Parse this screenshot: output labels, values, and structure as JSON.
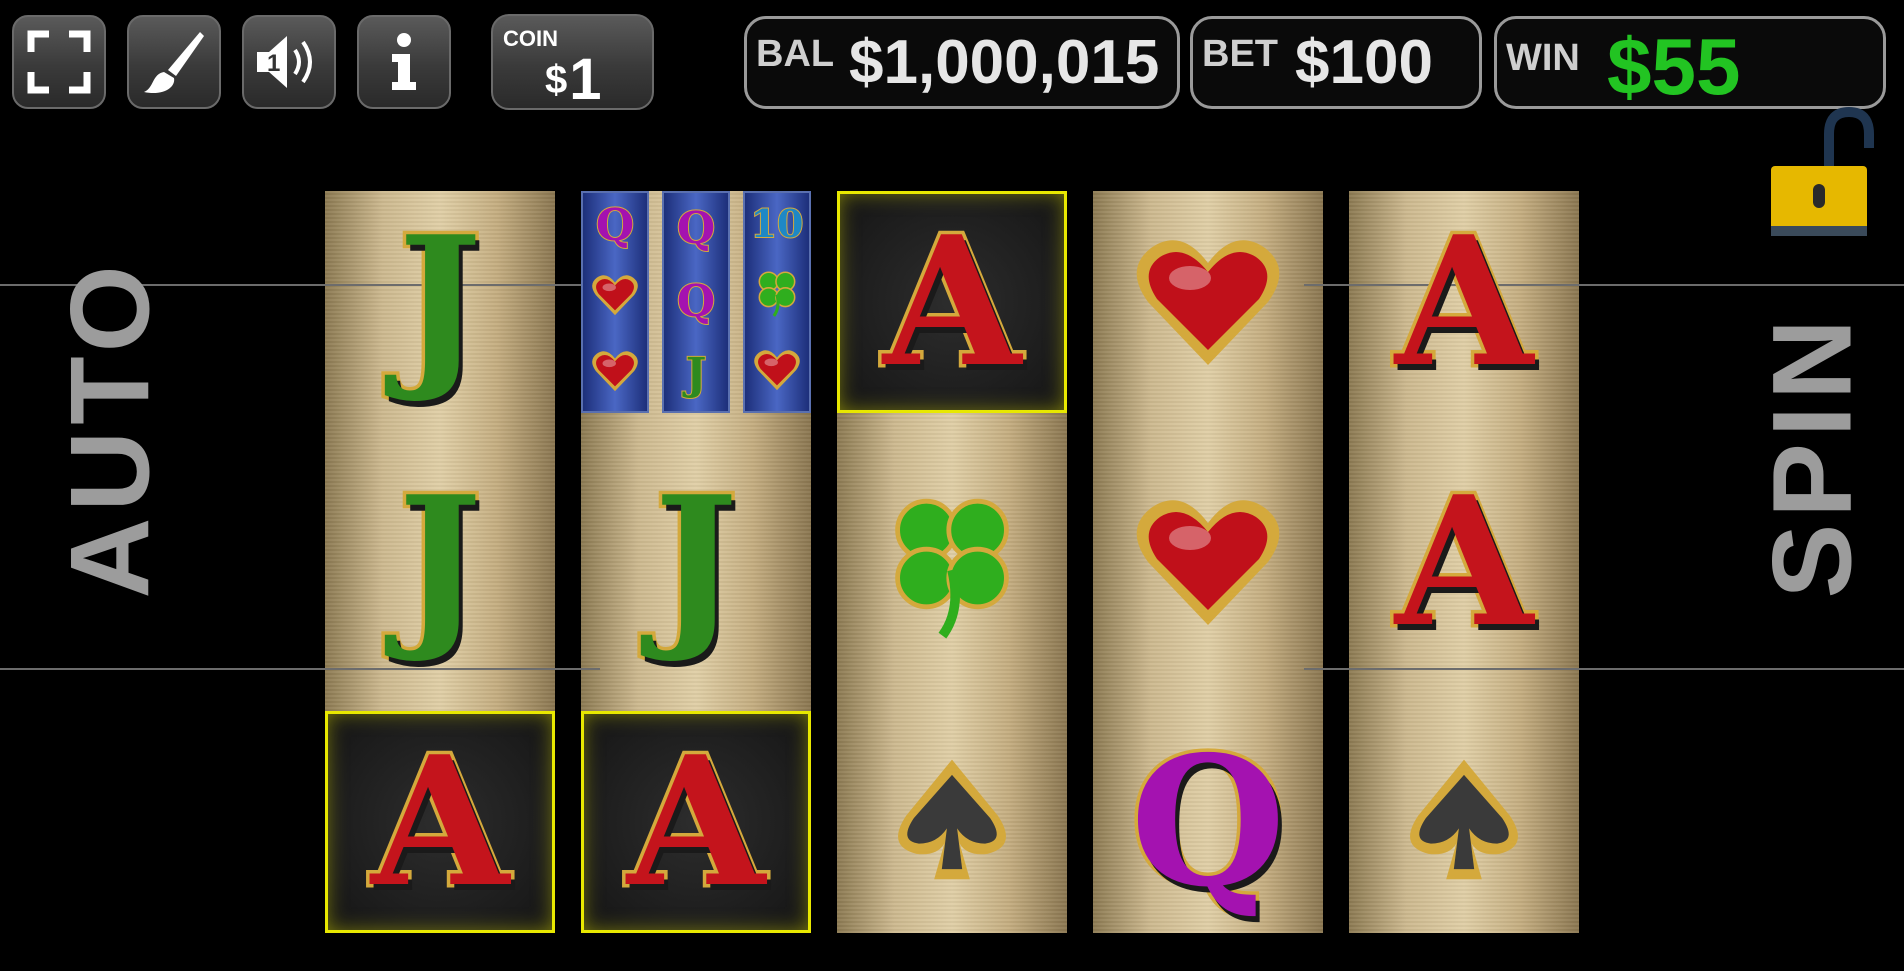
{
  "toolbar": {
    "buttons": [
      {
        "name": "fullscreen",
        "icon": "fullscreen-icon"
      },
      {
        "name": "paint",
        "icon": "brush-icon"
      },
      {
        "name": "sound",
        "icon": "speaker-icon",
        "level": "1"
      },
      {
        "name": "info",
        "icon": "info-icon"
      }
    ],
    "coin": {
      "label": "COIN",
      "currency": "$",
      "value": "1"
    }
  },
  "meters": {
    "balance": {
      "label": "BAL",
      "value": "$1,000,015",
      "color": "#e6e6e6"
    },
    "bet": {
      "label": "BET",
      "value": "$100",
      "color": "#e6e6e6"
    },
    "win": {
      "label": "WIN",
      "value": "$55",
      "color": "#22c422"
    }
  },
  "lock": {
    "icon": "unlocked-padlock-icon",
    "color": "#e6b800"
  },
  "reels": [
    [
      "J",
      "J",
      "A"
    ],
    [
      "mini",
      "J",
      "A"
    ],
    [
      "A",
      "clover",
      "spade"
    ],
    [
      "heart",
      "heart",
      "Q"
    ],
    [
      "A",
      "A",
      "spade"
    ]
  ],
  "highlighted": [
    [
      0,
      2
    ],
    [
      1,
      2
    ],
    [
      2,
      0
    ]
  ],
  "mini_reels": [
    [
      "Q",
      "heart",
      "heart"
    ],
    [
      "Q",
      "Q",
      "J"
    ],
    [
      "10",
      "clover",
      "heart"
    ]
  ],
  "side_buttons": {
    "auto": "AUTO",
    "spin": "SPIN"
  },
  "colors": {
    "highlight": "#e8e800",
    "win_text": "#22c422",
    "reel_gold": "#cdb98f"
  }
}
